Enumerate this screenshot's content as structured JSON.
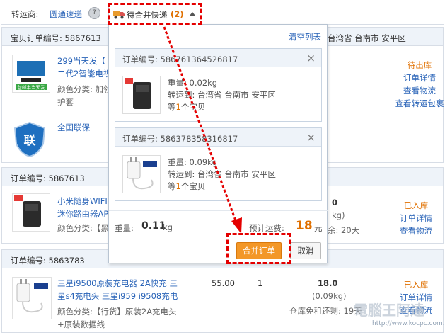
{
  "topbar": {
    "label": "转运商:",
    "carrier": "圆通速递",
    "bubble": "?",
    "merge_tab_label": "待合并快递",
    "merge_tab_count": "(2)"
  },
  "orders": [
    {
      "order_no_label": "宝贝订单编号:  5867613",
      "dest": "台湾省 台南市 安平区",
      "title_line1": "299当天发【",
      "title_line2": "二代2智能电视",
      "attr_line1": "颜色分类: 加领",
      "attr_line2": "护套",
      "badge": "联",
      "badge_label": "全国联保",
      "img_caption": "包邮丰当天发",
      "status": "待出库",
      "links": [
        "订单详情",
        "查看物流",
        "查看转运包裹"
      ]
    },
    {
      "order_no_label": "订单编号:  5867613",
      "title_line1": "小米随身WIFI",
      "title_line2": "迷你路由器AP",
      "attr_line1": "颜色分类:【黑",
      "weight_tail": "0",
      "weight_sub": "kg)",
      "remain_tail": "余:  20天",
      "status": "已入库",
      "links": [
        "订单详情",
        "查看物流"
      ]
    },
    {
      "order_no_label": "订单编号:  5863783",
      "title_line1": "三星i9500原装充电器 2A快充 三",
      "title_line2": "星s4充电头 三星i959 i9508充电",
      "attr_line1": "颜色分类:【行货】原装2A充电头",
      "attr_line2": "+原装数据线",
      "price": "55.00",
      "qty": "1",
      "weight": "18.0",
      "weight_sub": "(0.09kg)",
      "remain": "仓库免租还剩: 19天",
      "status": "已入库",
      "links": [
        "订单详情",
        "查看物流"
      ]
    }
  ],
  "popup": {
    "clear_label": "清空列表",
    "cards": [
      {
        "order_no": "订单编号: 586761364526817",
        "weight": "重量: 0.02kg",
        "route": "转运到: 台湾省 台南市 安平区",
        "count_pre": "等",
        "count_num": "1",
        "count_post": "个宝贝",
        "close": "×"
      },
      {
        "order_no": "订单编号: 586378358316817",
        "weight": "重量: 0.09kg",
        "route": "转运到: 台湾省 台南市 安平区",
        "count_pre": "等",
        "count_num": "1",
        "count_post": "个宝贝",
        "close": "×"
      }
    ],
    "weight_label": "重量:",
    "weight_value": "0.11",
    "weight_unit": "kg",
    "fee_label": "预计运费:",
    "fee_value": "18",
    "fee_unit": "元",
    "merge_button": "合并订单",
    "cancel_button": "取消"
  },
  "watermark": {
    "text": "電腦王阿達",
    "url": "http://www.kocpc.com.tw"
  },
  "colors": {
    "accent": "#f39727",
    "link": "#2a64b8",
    "highlight": "#e40000",
    "header_bg": "#eef3f9"
  }
}
